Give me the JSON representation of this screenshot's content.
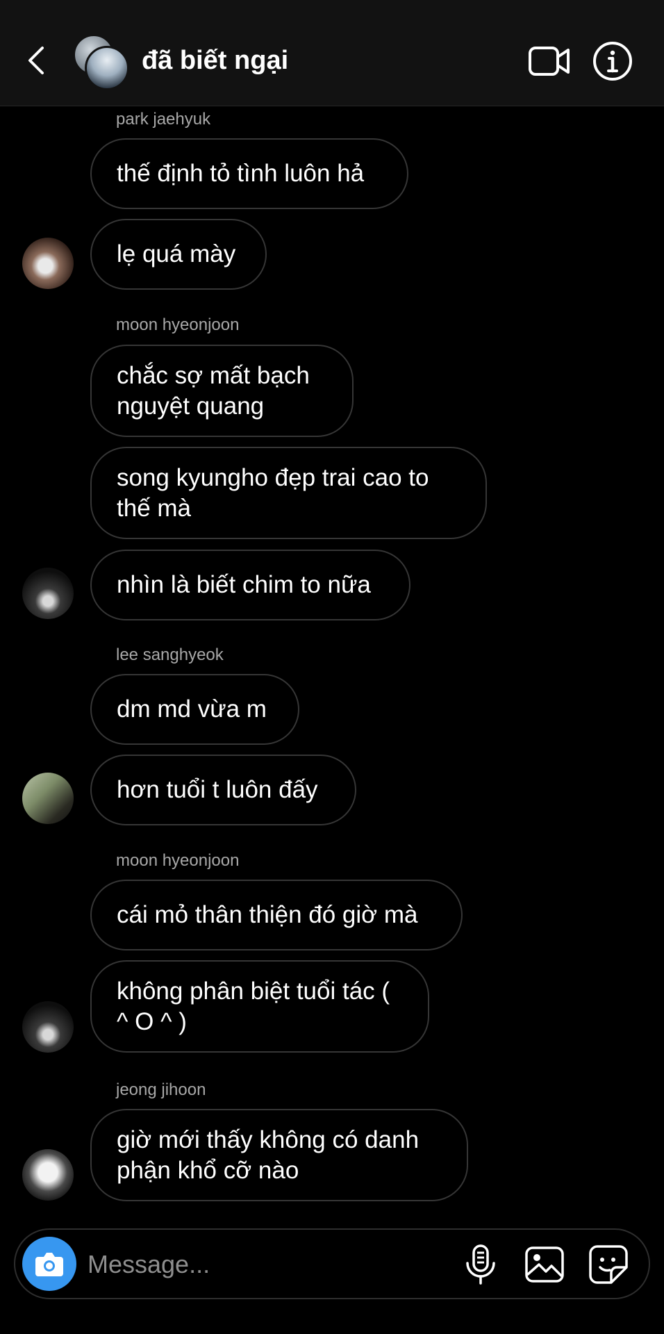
{
  "header": {
    "title": "đã biết ngại",
    "icons": [
      "chevron-left-icon",
      "video-camera-icon",
      "info-icon"
    ]
  },
  "messages": [
    {
      "sender": "park jaehyuk",
      "bubbles": [
        "thế định tỏ tình luôn hả",
        "lẹ quá mày"
      ]
    },
    {
      "sender": "moon hyeonjoon",
      "bubbles": [
        "chắc sợ mất bạch nguyệt quang",
        "song kyungho đẹp trai cao to thế mà",
        "nhìn là biết chim to nữa"
      ]
    },
    {
      "sender": "lee sanghyeok",
      "bubbles": [
        "dm md vừa m",
        "hơn tuổi t luôn đấy"
      ]
    },
    {
      "sender": "moon hyeonjoon",
      "bubbles": [
        "cái mỏ thân thiện đó giờ mà",
        "không phân biệt tuổi tác ( ^ O ^ )"
      ]
    },
    {
      "sender": "jeong jihoon",
      "bubbles": [
        "giờ mới thấy không có danh phận khổ cỡ nào"
      ]
    }
  ],
  "composer": {
    "placeholder": "Message...",
    "icons": [
      "camera-icon",
      "microphone-icon",
      "gallery-icon",
      "sticker-icon"
    ]
  },
  "colors": {
    "background": "#000000",
    "header_bg": "#121212",
    "bubble_border": "#363636",
    "sender_text": "#a8a8a8",
    "camera_accent": "#3797f0"
  }
}
